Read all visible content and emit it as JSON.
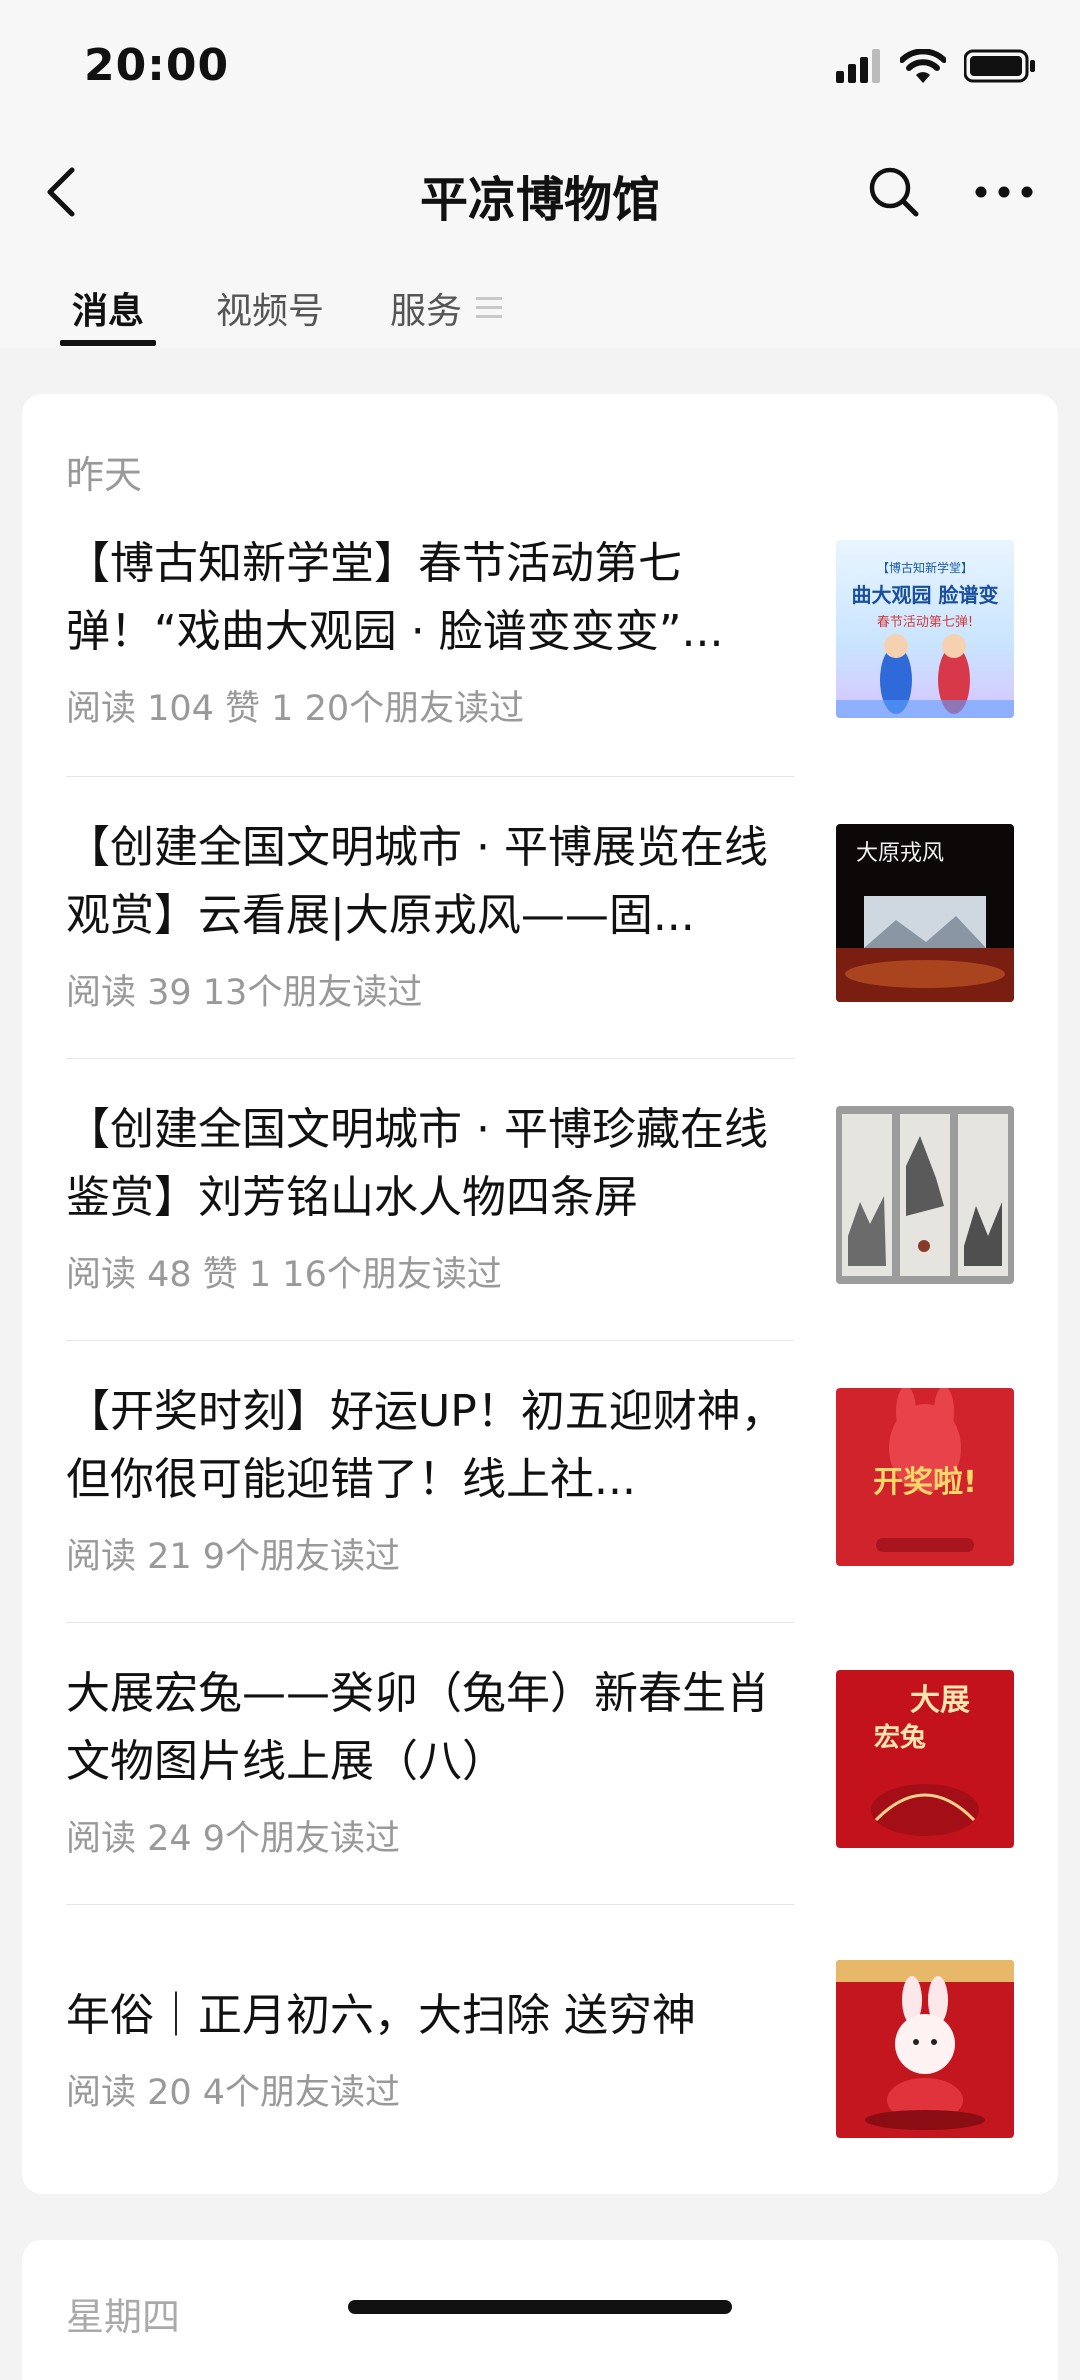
{
  "status_bar": {
    "time": "20:00"
  },
  "navbar": {
    "title": "平凉博物馆"
  },
  "tabs": [
    {
      "label": "消息",
      "active": true
    },
    {
      "label": "视频号",
      "active": false
    },
    {
      "label": "服务",
      "active": false
    }
  ],
  "sections": [
    {
      "date_label": "昨天",
      "articles": [
        {
          "title": "【博古知新学堂】春节活动第七弹！“戏曲大观园 · 脸谱变变变”...",
          "meta": "阅读 104  赞 1  20个朋友读过",
          "thumb_text": "【博古知新学堂】 曲大观园 脸谱变 春节活动第七弹!"
        },
        {
          "title": "【创建全国文明城市 · 平博展览在线观赏】云看展|大原戎风——固...",
          "meta": "阅读 39  13个朋友读过",
          "thumb_text": "大原戎风"
        },
        {
          "title": "【创建全国文明城市 · 平博珍藏在线鉴赏】刘芳铭山水人物四条屏",
          "meta": "阅读 48  赞 1  16个朋友读过",
          "thumb_text": ""
        },
        {
          "title": "【开奖时刻】好运UP！初五迎财神，但你很可能迎错了！线上社...",
          "meta": "阅读 21  9个朋友读过",
          "thumb_text": "开奖啦!"
        },
        {
          "title": "大展宏兔——癸卯（兔年）新春生肖文物图片线上展（八）",
          "meta": "阅读 24  9个朋友读过",
          "thumb_text": "大展宏兔"
        },
        {
          "title": "年俗｜正月初六，大扫除 送穷神",
          "meta": "阅读 20  4个朋友读过",
          "thumb_text": ""
        }
      ]
    },
    {
      "date_label": "星期四"
    }
  ]
}
